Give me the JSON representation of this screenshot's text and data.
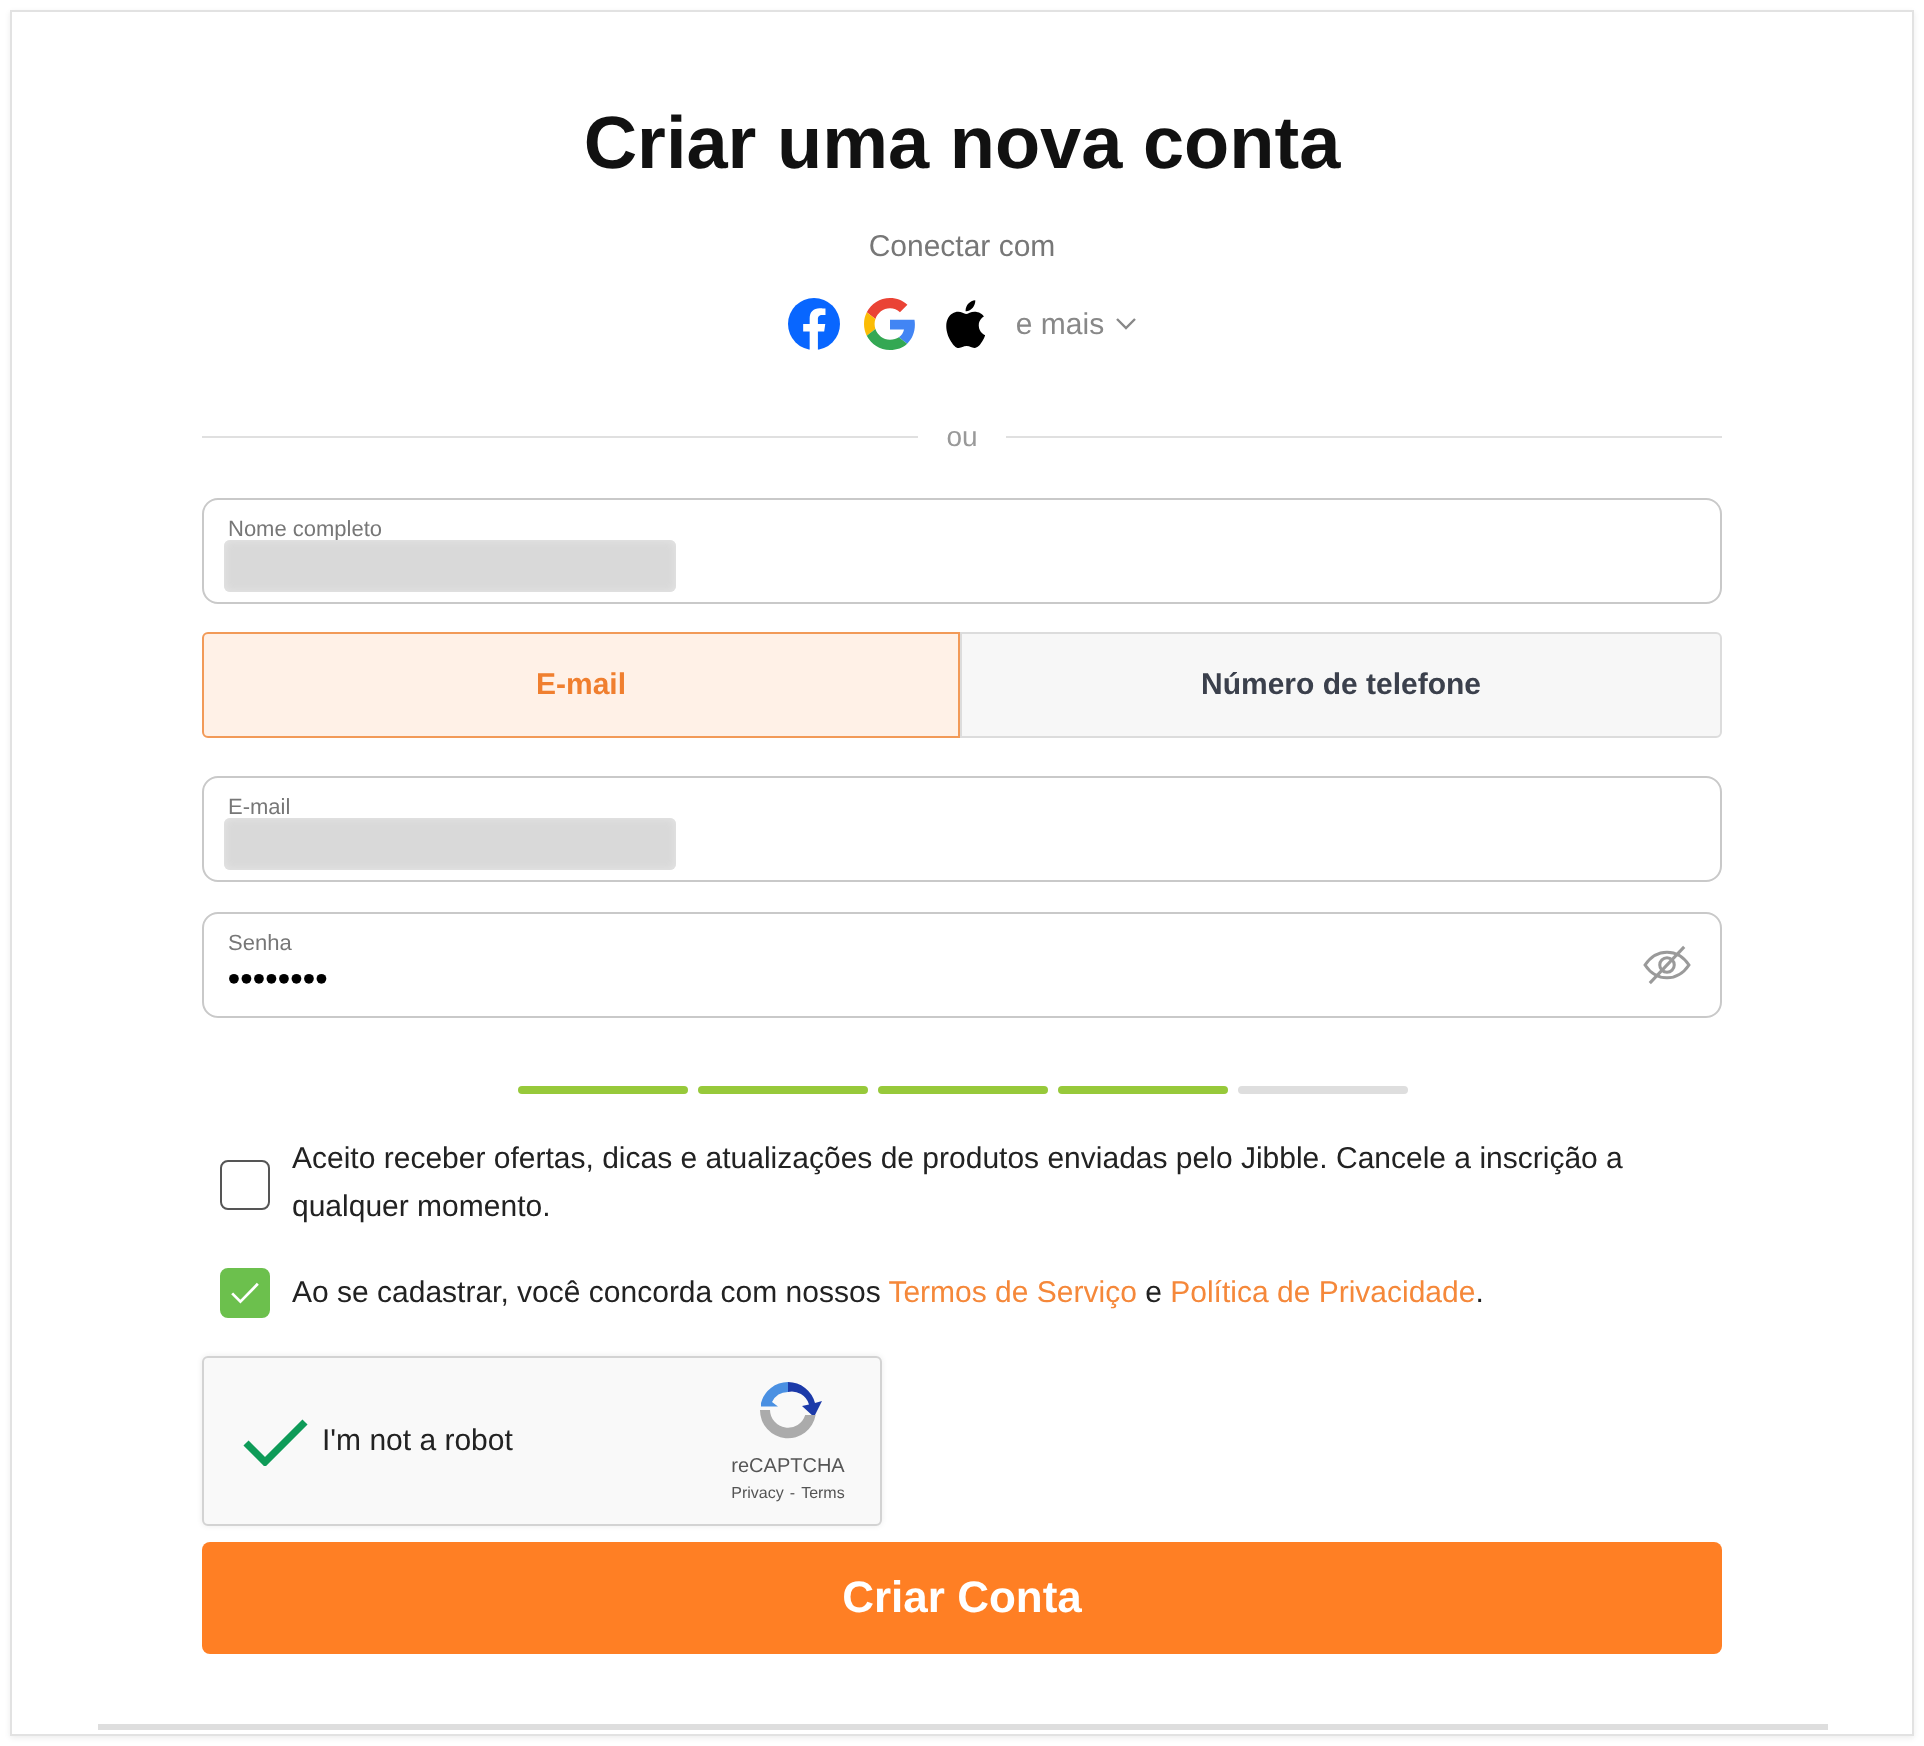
{
  "title": "Criar uma nova conta",
  "social": {
    "label": "Conectar com",
    "more": "e mais"
  },
  "divider_text": "ou",
  "name_field": {
    "label": "Nome completo",
    "value_blurred": true
  },
  "contact_tabs": [
    {
      "label": "E-mail",
      "selected": true
    },
    {
      "label": "Número de telefone",
      "selected": false
    }
  ],
  "email_field": {
    "label": "E-mail",
    "value_blurred": true
  },
  "password_field": {
    "label": "Senha",
    "value": "••••••••"
  },
  "strength_meter": {
    "segments": [
      {
        "filled": true
      },
      {
        "filled": true
      },
      {
        "filled": true
      },
      {
        "filled": true
      },
      {
        "filled": false
      }
    ]
  },
  "consents": [
    {
      "checked": false,
      "parts": [
        {
          "text": "Aceito receber ofertas, dicas e atualizações de produtos enviadas pelo Jibble. Cancele a inscrição a qualquer momento.",
          "link": false
        }
      ]
    },
    {
      "checked": true,
      "parts": [
        {
          "text": "Ao se cadastrar, você concorda com nossos ",
          "link": false
        },
        {
          "text": "Termos de Serviço",
          "link": true
        },
        {
          "text": " e ",
          "link": false
        },
        {
          "text": "Política de Privacidade",
          "link": true
        },
        {
          "text": ".",
          "link": false
        }
      ]
    }
  ],
  "captcha": {
    "checked": true,
    "label": "I'm not a robot",
    "brand": "reCAPTCHA",
    "links": [
      "Privacy",
      "Terms"
    ],
    "separator": "-"
  },
  "submit": "Criar Conta"
}
